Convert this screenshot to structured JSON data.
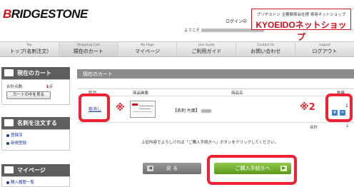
{
  "header": {
    "logo": "BRIDGESTONE",
    "login_label": "ログイン中",
    "greeting_prefix": "ようこそ",
    "shop_subtitle": "ブリヂストン 主要関係会社様 専用ネットショップ",
    "shop_name": "KYOEIDOネットショップ"
  },
  "nav": [
    {
      "en": "Top",
      "ja": "トップ(名刺注文)"
    },
    {
      "en": "Shopping Cart",
      "ja": "現在のカート"
    },
    {
      "en": "My Page",
      "ja": "マイページ"
    },
    {
      "en": "Use Guide",
      "ja": "ご利用ガイド"
    },
    {
      "en": "Contact Us",
      "ja": "お問い合わせ"
    },
    {
      "en": "Logout",
      "ja": "ログアウト"
    }
  ],
  "sidebar": {
    "cart": {
      "title": "現在のカート",
      "count_label": "合計点数:",
      "count_value": "1",
      "count_unit": "点",
      "view_button": "カートの中を見る"
    },
    "order": {
      "title": "名刺を注文する",
      "links": [
        "登録済",
        "新規登録"
      ]
    },
    "mypage": {
      "title": "マイページ",
      "links": [
        "購入履歴一覧"
      ]
    }
  },
  "main": {
    "section_title": "現在のカート",
    "columns": {
      "delete": "取消",
      "image": "商品画像",
      "name": "商品名",
      "qty": "数量"
    },
    "row": {
      "delete_link": "取消し",
      "product_name": "【名刺 片面】",
      "quantity": "1"
    },
    "marks": {
      "image_note": "※",
      "qty_note": "※2"
    },
    "qty_plus": "+",
    "qty_minus": "−",
    "total_label": "合計",
    "total_value": "1",
    "instruction": "上記内容でよろしければ「ご購入手続きへ」ボタンをクリックしてください。",
    "back_button": "戻 る",
    "proceed_button": "ご購入手続きへ"
  },
  "colors": {
    "brand_red": "#d0101b",
    "highlight_red": "#ee2233",
    "proceed_green": "#6fae2a",
    "link_blue": "#1a3c9a",
    "header_grey": "#5e5e5e"
  }
}
